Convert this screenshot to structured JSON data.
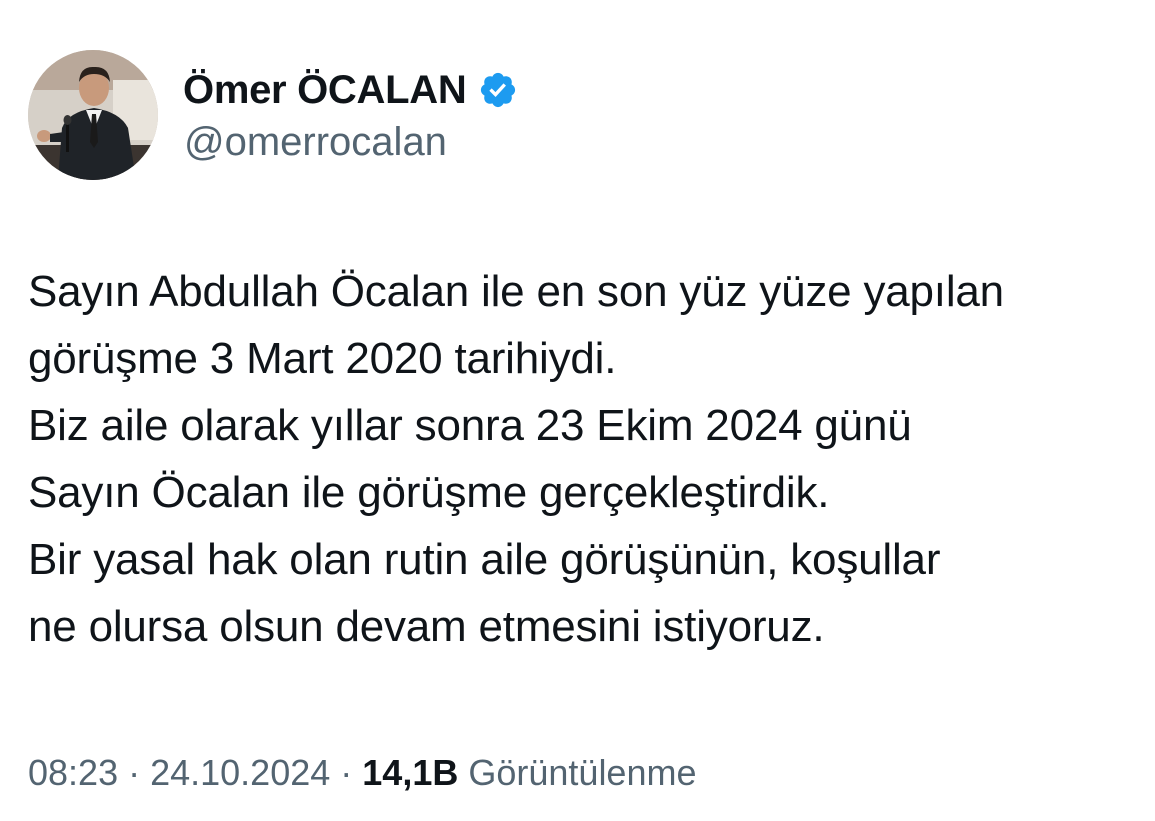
{
  "author": {
    "display_name": "Ömer ÖCALAN",
    "handle": "@omerrocalan",
    "verified_icon": "verified-badge-icon",
    "verified_color": "#1d9bf0"
  },
  "tweet": {
    "lines": [
      "Sayın Abdullah Öcalan ile en son yüz yüze yapılan",
      "görüşme 3 Mart 2020 tarihiydi.",
      "Biz aile olarak yıllar sonra 23 Ekim 2024 günü",
      "Sayın Öcalan ile görüşme gerçekleştirdik.",
      "Bir yasal hak olan rutin aile görüşünün, koşullar",
      "ne olursa olsun devam etmesini istiyoruz."
    ]
  },
  "meta": {
    "time": "08:23",
    "separator": "·",
    "date": "24.10.2024",
    "views_count": "14,1B",
    "views_label": "Görüntülenme"
  },
  "colors": {
    "text_primary": "#0f1419",
    "text_secondary": "#536471",
    "background": "#ffffff"
  }
}
